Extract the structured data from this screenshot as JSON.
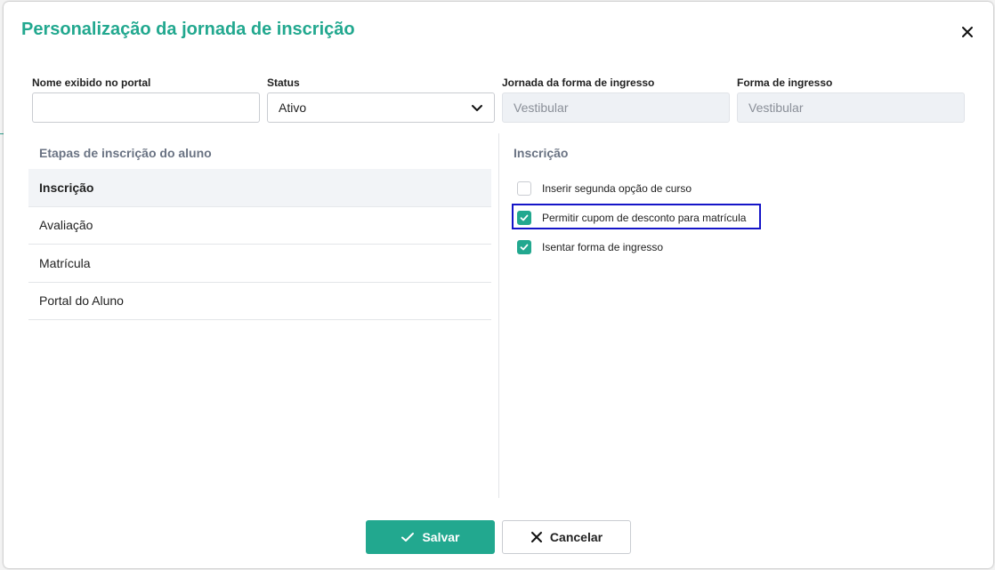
{
  "modal": {
    "title": "Personalização da jornada de inscrição"
  },
  "fields": {
    "nome_label": "Nome exibido no portal",
    "nome_value": "",
    "status_label": "Status",
    "status_value": "Ativo",
    "jornada_label": "Jornada da forma de ingresso",
    "jornada_value": "Vestibular",
    "forma_label": "Forma de ingresso",
    "forma_value": "Vestibular"
  },
  "steps": {
    "title": "Etapas de inscrição do aluno",
    "items": [
      {
        "label": "Inscrição",
        "active": true
      },
      {
        "label": "Avaliação",
        "active": false
      },
      {
        "label": "Matrícula",
        "active": false
      },
      {
        "label": "Portal do Aluno",
        "active": false
      }
    ]
  },
  "options": {
    "title": "Inscrição",
    "items": [
      {
        "label": "Inserir segunda opção de curso",
        "checked": false
      },
      {
        "label": "Permitir cupom de desconto para matrícula",
        "checked": true
      },
      {
        "label": "Isentar forma de ingresso",
        "checked": true
      }
    ]
  },
  "buttons": {
    "save": "Salvar",
    "cancel": "Cancelar"
  },
  "colors": {
    "accent": "#22a88f",
    "highlight": "#1515c8"
  }
}
